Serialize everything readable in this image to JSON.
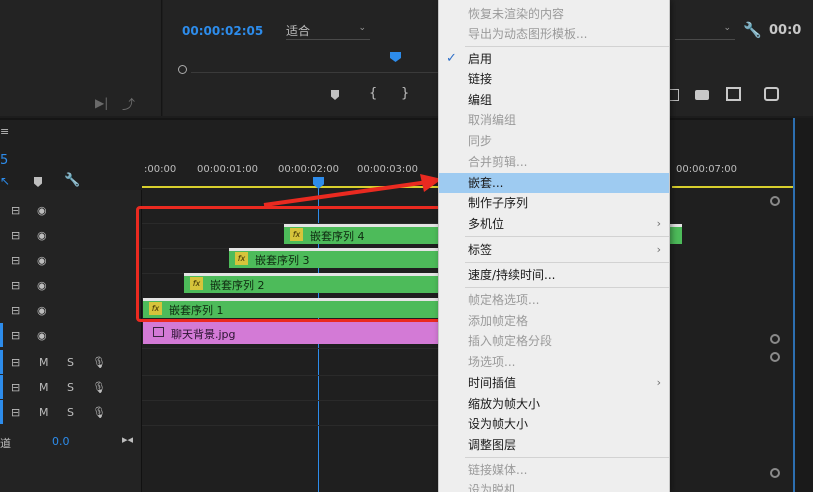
{
  "source_monitor": {
    "icons": [
      "insert-icon",
      "export-frame-icon"
    ]
  },
  "program_monitor": {
    "timecode": "00:00:02:05",
    "fit_value": "适合",
    "timecode_right": "00:0"
  },
  "timeline": {
    "sequence_timecode_fragment": "5",
    "ruler_ticks": [
      ":00:00",
      "00:00:01:00",
      "00:00:02:00",
      "00:00:03:00",
      "00:00:07:00"
    ],
    "video_tracks": 5,
    "audio_tracks": [
      {
        "m": "M",
        "s": "S"
      },
      {
        "m": "M",
        "s": "S"
      },
      {
        "m": "M",
        "s": "S"
      }
    ],
    "master_label": "道",
    "master_value": "0.0",
    "clips": [
      {
        "fx": "fx",
        "label": "嵌套序列 4"
      },
      {
        "fx": "fx",
        "label": "嵌套序列 3"
      },
      {
        "fx": "fx",
        "label": "嵌套序列 2"
      },
      {
        "fx": "fx",
        "label": "嵌套序列 1"
      }
    ],
    "image_clip": "聊天背景.jpg"
  },
  "context_menu": {
    "items": [
      {
        "label": "恢复未渲染的内容",
        "disabled": true
      },
      {
        "label": "导出为动态图形模板...",
        "disabled": true
      },
      {
        "label": "启用",
        "checked": true
      },
      {
        "label": "链接"
      },
      {
        "label": "编组"
      },
      {
        "label": "取消编组",
        "disabled": true
      },
      {
        "label": "同步",
        "disabled": true
      },
      {
        "label": "合并剪辑...",
        "disabled": true
      },
      {
        "label": "嵌套...",
        "highlighted": true
      },
      {
        "label": "制作子序列"
      },
      {
        "label": "多机位",
        "submenu": true
      },
      {
        "label": "标签",
        "submenu": true
      },
      {
        "label": "速度/持续时间..."
      },
      {
        "label": "帧定格选项...",
        "disabled": true
      },
      {
        "label": "添加帧定格",
        "disabled": true
      },
      {
        "label": "插入帧定格分段",
        "disabled": true
      },
      {
        "label": "场选项...",
        "disabled": true
      },
      {
        "label": "时间插值",
        "submenu": true
      },
      {
        "label": "缩放为帧大小"
      },
      {
        "label": "设为帧大小"
      },
      {
        "label": "调整图层"
      },
      {
        "label": "链接媒体...",
        "disabled": true
      },
      {
        "label": "设为脱机...",
        "disabled": true
      }
    ],
    "submenu_glyph": "›",
    "check_glyph": "✓"
  },
  "colors": {
    "accent": "#2d8ceb",
    "clip_green": "#4dbb5a",
    "clip_pink": "#d37ad6",
    "highlight": "#ea2a20",
    "menu_selected": "#9ecbf1"
  }
}
